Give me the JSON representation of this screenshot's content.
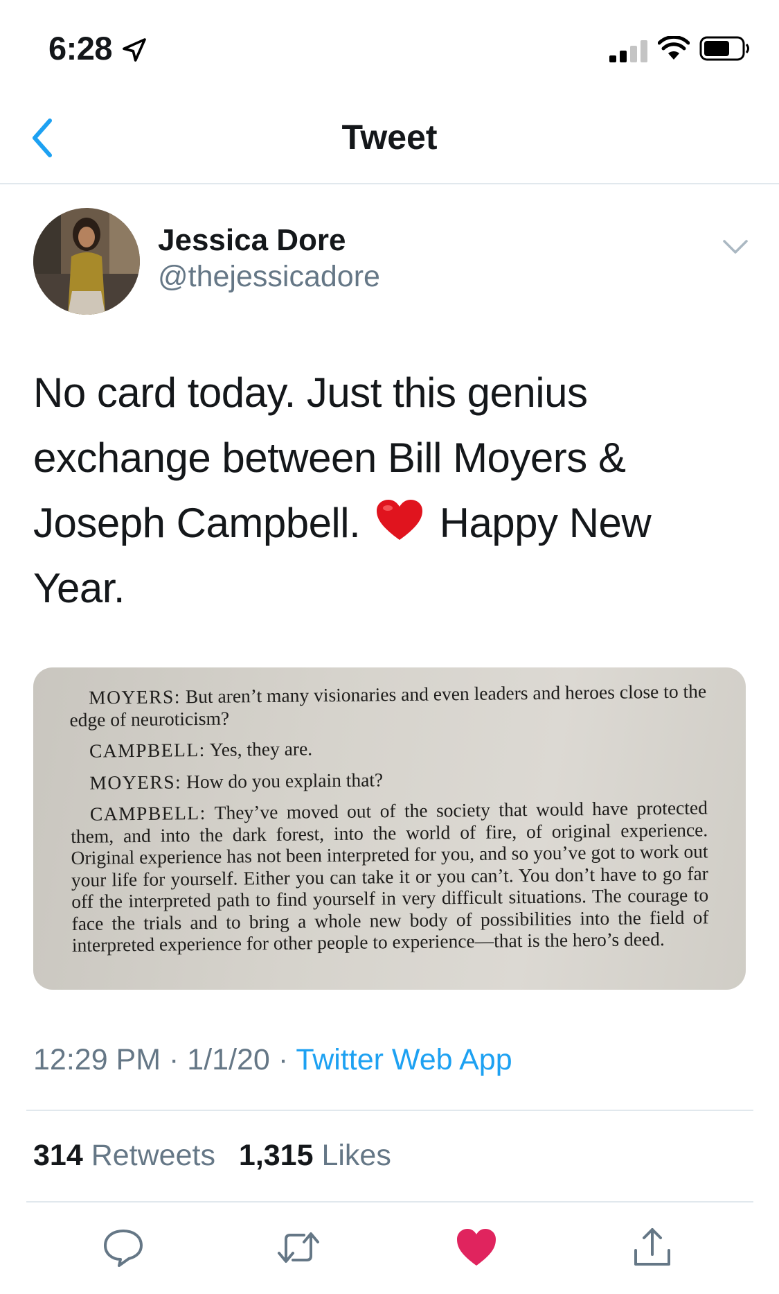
{
  "status_bar": {
    "time": "6:28"
  },
  "nav": {
    "title": "Tweet"
  },
  "author": {
    "name": "Jessica Dore",
    "handle": "@thejessicadore"
  },
  "tweet": {
    "text_before_emoji": "No card today. Just this genius exchange between Bill Moyers & Joseph Campbell.",
    "text_after_emoji": "Happy New Year."
  },
  "photo": {
    "paragraphs": [
      {
        "speaker": "MOYERS:",
        "text": "But aren’t many visionaries and even leaders and heroes close to the edge of neuroticism?"
      },
      {
        "speaker": "CAMPBELL:",
        "text": "Yes, they are."
      },
      {
        "speaker": "MOYERS:",
        "text": "How do you explain that?"
      },
      {
        "speaker": "CAMPBELL:",
        "text": "They’ve moved out of the society that would have protected them, and into the dark forest, into the world of fire, of original experience. Original experience has not been interpreted for you, and so you’ve got to work out your life for yourself. Either you can take it or you can’t. You don’t have to go far off the interpreted path to find yourself in very difficult situations. The courage to face the trials and to bring a whole new body of possibilities into the field of interpreted experience for other people to experience—that is the hero’s deed."
      }
    ]
  },
  "meta": {
    "time": "12:29 PM",
    "date": "1/1/20",
    "separator": "·",
    "source": "Twitter Web App"
  },
  "stats": {
    "retweets_count": "314",
    "retweets_label": "Retweets",
    "likes_count": "1,315",
    "likes_label": "Likes"
  },
  "colors": {
    "accent": "#1da1f2",
    "like": "#e0245e",
    "secondary": "#657786",
    "divider": "#e1e8ed"
  },
  "icons": {
    "status": [
      "location-arrow-icon",
      "signal-icon",
      "wifi-icon",
      "battery-icon"
    ],
    "actions": [
      "reply-icon",
      "retweet-icon",
      "like-icon",
      "share-icon"
    ]
  }
}
